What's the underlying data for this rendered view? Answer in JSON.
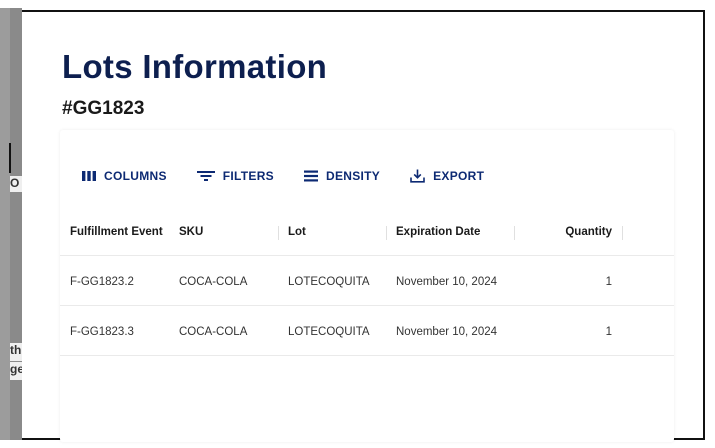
{
  "background": {
    "fragment_1": "O",
    "fragment_2": "th",
    "fragment_3": "ge"
  },
  "modal": {
    "title": "Lots Information",
    "subtitle": "#GG1823"
  },
  "toolbar": {
    "columns_label": "COLUMNS",
    "filters_label": "FILTERS",
    "density_label": "DENSITY",
    "export_label": "EXPORT"
  },
  "table": {
    "headers": [
      "Fulfillment Event",
      "SKU",
      "Lot",
      "Expiration Date",
      "Quantity"
    ],
    "rows": [
      {
        "fulfillment_event": "F-GG1823.2",
        "sku": "COCA-COLA",
        "lot": "LOTECOQUITA",
        "expiration_date": "November 10, 2024",
        "quantity": "1"
      },
      {
        "fulfillment_event": "F-GG1823.3",
        "sku": "COCA-COLA",
        "lot": "LOTECOQUITA",
        "expiration_date": "November 10, 2024",
        "quantity": "1"
      }
    ]
  },
  "colors": {
    "title": "#0d1f4f",
    "toolbar_accent": "#0d2a73"
  }
}
